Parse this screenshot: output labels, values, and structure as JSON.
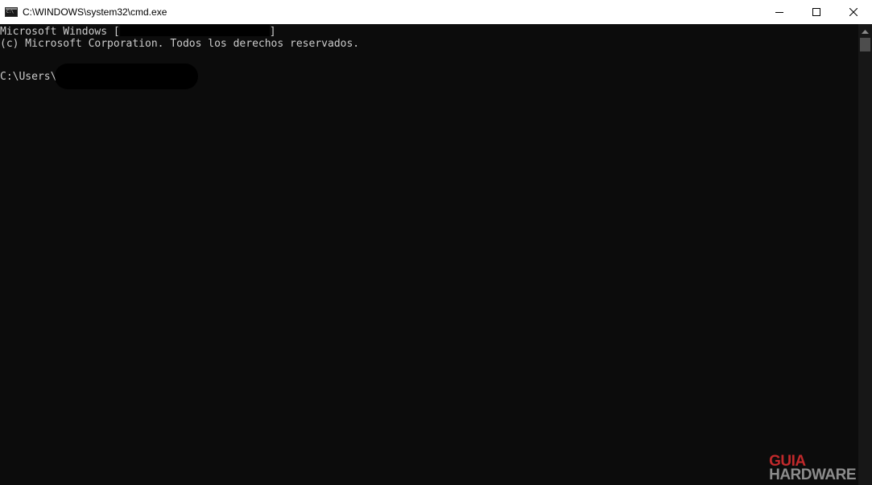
{
  "window": {
    "title": "C:\\WINDOWS\\system32\\cmd.exe",
    "icon": "cmd-icon",
    "controls": [
      "minimize-icon",
      "maximize-icon",
      "close-icon"
    ]
  },
  "console": {
    "line1_prefix": "Microsoft Windows [",
    "line1_suffix": "]",
    "line2": "(c) Microsoft Corporation. Todos los derechos reservados.",
    "prompt": "C:\\Users\\"
  },
  "watermark": {
    "top": "GUIA",
    "bottom": "HARDWARE"
  },
  "colors": {
    "background": "#0c0c0c",
    "text": "#cccccc",
    "titlebar": "#ffffff",
    "watermark_red": "#c0292b",
    "watermark_gray": "#8c8c8c"
  }
}
